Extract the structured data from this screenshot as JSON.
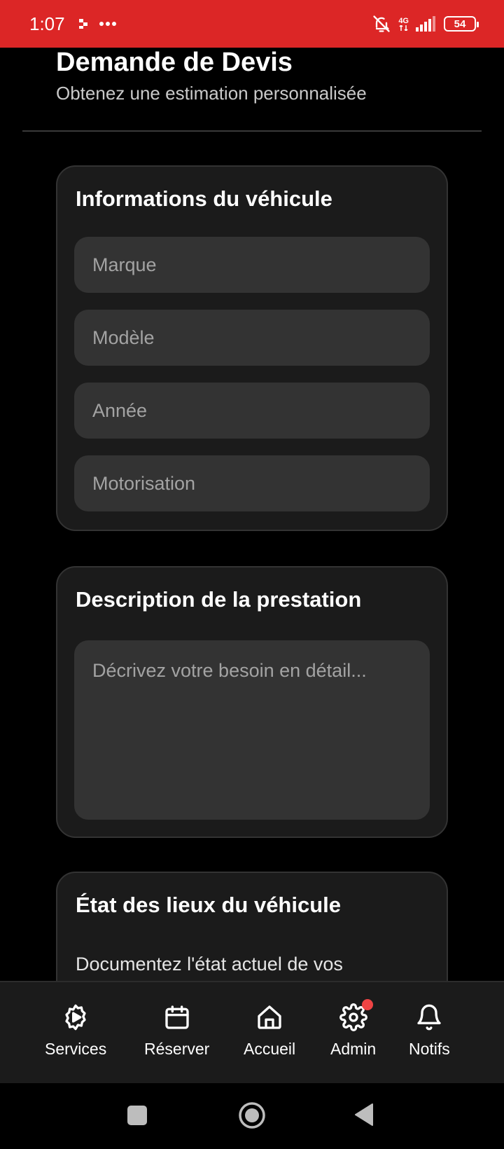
{
  "status_bar": {
    "time": "1:07",
    "network": "4G",
    "battery": "54",
    "background_color": "#dc2626"
  },
  "header": {
    "title": "Demande de Devis",
    "subtitle": "Obtenez une estimation personnalisée"
  },
  "vehicle_card": {
    "title": "Informations du véhicule",
    "fields": [
      {
        "placeholder": "Marque",
        "value": ""
      },
      {
        "placeholder": "Modèle",
        "value": ""
      },
      {
        "placeholder": "Année",
        "value": ""
      },
      {
        "placeholder": "Motorisation",
        "value": ""
      }
    ]
  },
  "description_card": {
    "title": "Description de la prestation",
    "placeholder": "Décrivez votre besoin en détail...",
    "value": ""
  },
  "inspection_card": {
    "title": "État des lieux du véhicule",
    "text": "Documentez l'état actuel de vos"
  },
  "bottom_nav": {
    "items": [
      {
        "label": "Services",
        "icon": "gear-play-icon"
      },
      {
        "label": "Réserver",
        "icon": "calendar-icon"
      },
      {
        "label": "Accueil",
        "icon": "home-icon"
      },
      {
        "label": "Admin",
        "icon": "gear-icon",
        "has_badge": true
      },
      {
        "label": "Notifs",
        "icon": "bell-icon"
      }
    ],
    "badge_color": "#ef4444"
  },
  "system_nav": {
    "buttons": [
      "recents",
      "home",
      "back"
    ]
  }
}
